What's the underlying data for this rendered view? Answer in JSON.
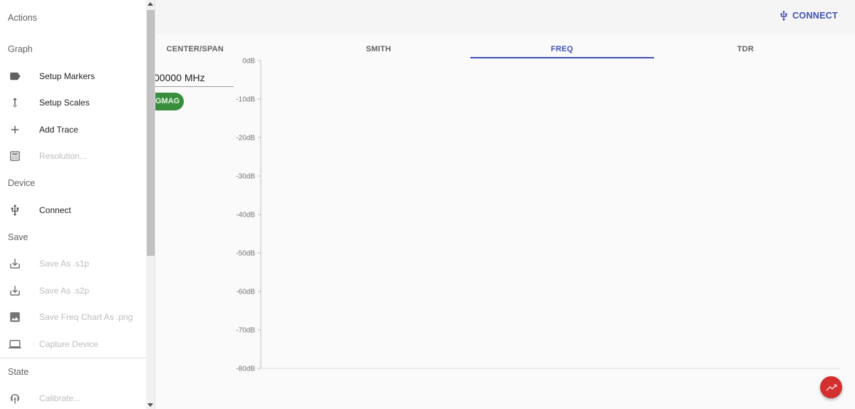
{
  "header": {
    "connect_label": "CONNECT",
    "connect_icon": "usb-icon",
    "accent_color": "#3f51b5"
  },
  "tabs": [
    {
      "label": "CENTER/SPAN",
      "active": false
    },
    {
      "label": "SMITH",
      "active": false
    },
    {
      "label": "FREQ",
      "active": true
    },
    {
      "label": "TDR",
      "active": false
    }
  ],
  "freq_input": {
    "value": "00000 MHz"
  },
  "mode_chip": {
    "label": "GMAG",
    "color": "#388e3c"
  },
  "chart": {
    "y_ticks": [
      "0dB",
      "-10dB",
      "-20dB",
      "-30dB",
      "-40dB",
      "-50dB",
      "-60dB",
      "-70dB",
      "-80dB"
    ],
    "ylim": [
      -80,
      0
    ]
  },
  "drawer": {
    "actions_header": "Actions",
    "graph_header": "Graph",
    "graph_items": [
      {
        "label": "Setup Markers",
        "icon": "label-icon",
        "disabled": false
      },
      {
        "label": "Setup Scales",
        "icon": "vertical-arrows-icon",
        "disabled": false
      },
      {
        "label": "Add Trace",
        "icon": "plus-icon",
        "disabled": false
      },
      {
        "label": "Resolution...",
        "icon": "calculator-icon",
        "disabled": true
      }
    ],
    "device_header": "Device",
    "device_items": [
      {
        "label": "Connect",
        "icon": "usb-icon",
        "disabled": false
      }
    ],
    "save_header": "Save",
    "save_items": [
      {
        "label": "Save As .s1p",
        "icon": "download-icon",
        "disabled": true
      },
      {
        "label": "Save As .s2p",
        "icon": "download-icon",
        "disabled": true
      },
      {
        "label": "Save Freq Chart As .png",
        "icon": "image-icon",
        "disabled": true
      },
      {
        "label": "Capture Device",
        "icon": "laptop-icon",
        "disabled": true
      }
    ],
    "state_header": "State",
    "state_items": [
      {
        "label": "Calibrate...",
        "icon": "antenna-icon",
        "disabled": true
      }
    ]
  },
  "fab": {
    "icon": "trending-up-icon",
    "color": "#d32f2f"
  }
}
